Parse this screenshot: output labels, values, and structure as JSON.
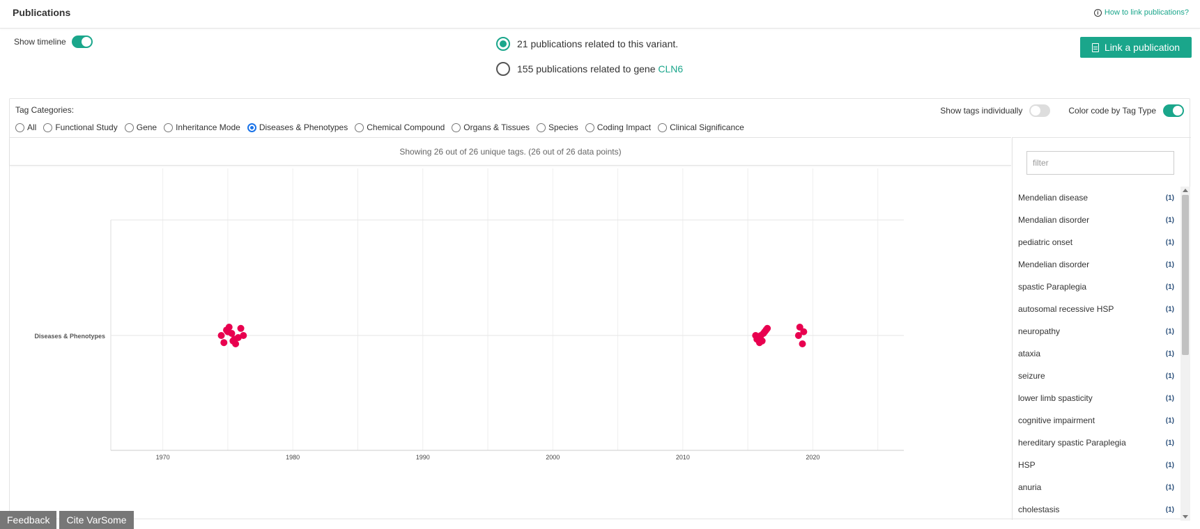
{
  "header": {
    "title": "Publications",
    "howto_link": "How to link publications?"
  },
  "timeline": {
    "label": "Show timeline",
    "on": true
  },
  "scope": {
    "variant_label": "21 publications related to this variant.",
    "gene_label_prefix": "155 publications related to gene ",
    "gene_name": "CLN6",
    "selected": "variant"
  },
  "link_button": {
    "label": "Link a publication"
  },
  "tag_categories": {
    "label": "Tag Categories:",
    "options": [
      "All",
      "Functional Study",
      "Gene",
      "Inheritance Mode",
      "Diseases & Phenotypes",
      "Chemical Compound",
      "Organs & Tissues",
      "Species",
      "Coding Impact",
      "Clinical Significance"
    ],
    "selected": "Diseases & Phenotypes"
  },
  "toggles": {
    "show_tags_individually": {
      "label": "Show tags individually",
      "on": false
    },
    "color_code": {
      "label": "Color code by Tag Type",
      "on": true
    }
  },
  "showing_text": "Showing 26 out of 26 unique tags. (26 out of 26 data points)",
  "filter": {
    "placeholder": "filter",
    "value": ""
  },
  "tags": [
    {
      "name": "Mendelian disease",
      "count": "(1)"
    },
    {
      "name": "Mendalian disorder",
      "count": "(1)"
    },
    {
      "name": "pediatric onset",
      "count": "(1)"
    },
    {
      "name": "Mendelian disorder",
      "count": "(1)"
    },
    {
      "name": "spastic Paraplegia",
      "count": "(1)"
    },
    {
      "name": "autosomal recessive HSP",
      "count": "(1)"
    },
    {
      "name": "neuropathy",
      "count": "(1)"
    },
    {
      "name": "ataxia",
      "count": "(1)"
    },
    {
      "name": "seizure",
      "count": "(1)"
    },
    {
      "name": "lower limb spasticity",
      "count": "(1)"
    },
    {
      "name": "cognitive impairment",
      "count": "(1)"
    },
    {
      "name": "hereditary spastic Paraplegia",
      "count": "(1)"
    },
    {
      "name": "HSP",
      "count": "(1)"
    },
    {
      "name": "anuria",
      "count": "(1)"
    },
    {
      "name": "cholestasis",
      "count": "(1)"
    }
  ],
  "footer": {
    "feedback": "Feedback",
    "cite": "Cite VarSome"
  },
  "colors": {
    "accent": "#1aa68b",
    "point": "#e8004f"
  },
  "chart_data": {
    "type": "scatter",
    "xlabel": "",
    "ylabel": "",
    "x_ticks": [
      1970,
      1980,
      1990,
      2000,
      2010,
      2020
    ],
    "xlim": [
      1966,
      2027
    ],
    "categories": [
      "Diseases & Phenotypes"
    ],
    "series": [
      {
        "category": "Diseases & Phenotypes",
        "x": [
          1974.5,
          1975,
          1975.5,
          1976,
          1974.7,
          1975.3,
          1975.8,
          1974.9,
          1975.4,
          1976.2,
          1975.1,
          1975.6,
          2016,
          2016.3,
          2015.7,
          2016.5,
          2015.9,
          2016.2,
          2015.8,
          2016.4,
          2016.1,
          2015.6,
          2019,
          2019.2,
          2018.9,
          2019.3
        ]
      }
    ]
  }
}
